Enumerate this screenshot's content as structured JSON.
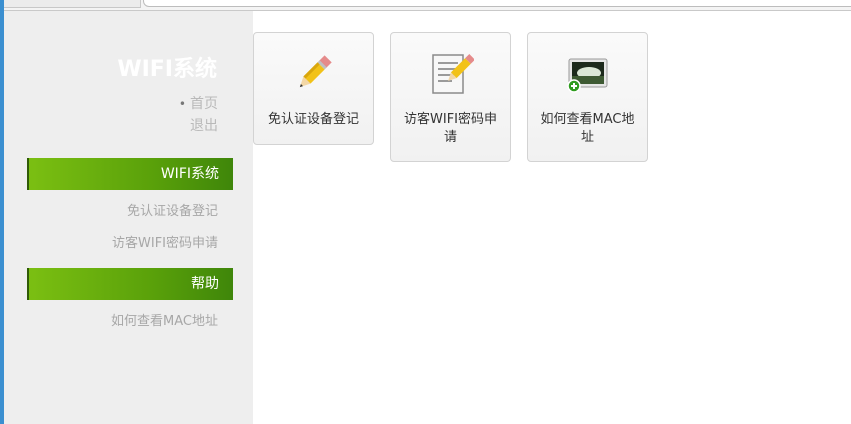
{
  "sidebar": {
    "brand": "WIFI系统",
    "links": {
      "home": "首页",
      "logout": "退出"
    },
    "sections": [
      {
        "title": "WIFI系统",
        "items": [
          "免认证设备登记",
          "访客WIFI密码申请"
        ]
      },
      {
        "title": "帮助",
        "items": [
          "如何查看MAC地址"
        ]
      }
    ]
  },
  "main": {
    "cards": [
      {
        "label": "免认证设备登记",
        "icon": "pencil-icon"
      },
      {
        "label": "访客WIFI密码申请",
        "icon": "edit-document-icon"
      },
      {
        "label": "如何查看MAC地址",
        "icon": "image-add-icon"
      }
    ]
  },
  "colors": {
    "accent_green": "#5aa10a",
    "sidebar_bg": "#eeeeee"
  }
}
